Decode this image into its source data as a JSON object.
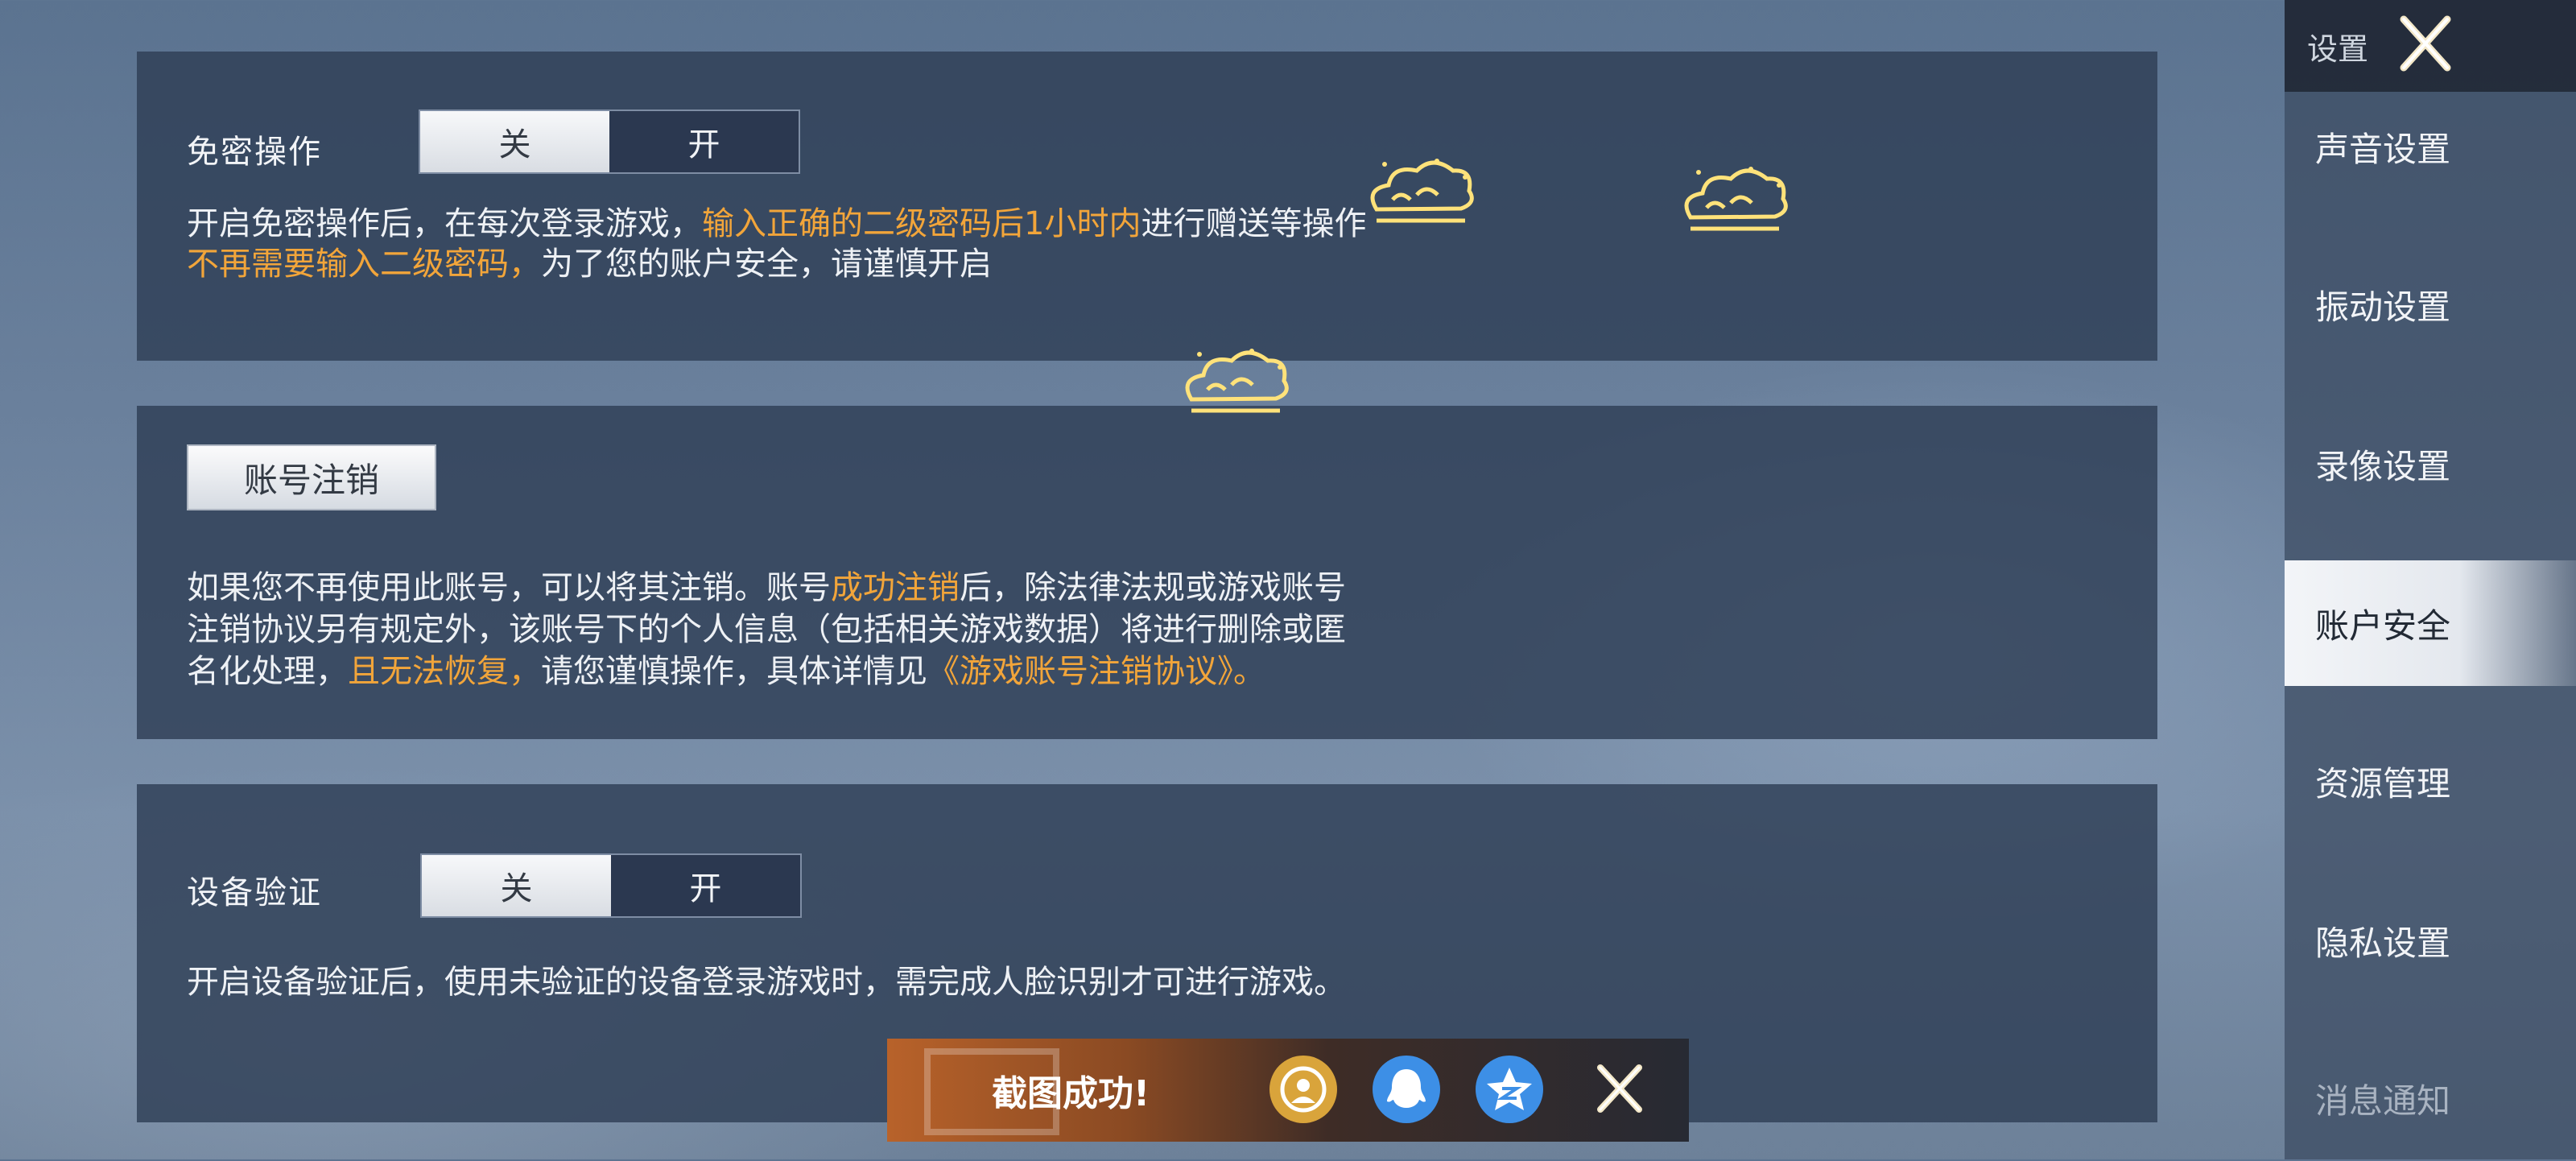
{
  "sidebar": {
    "title": "设置",
    "items": [
      {
        "label": "声音设置"
      },
      {
        "label": "振动设置"
      },
      {
        "label": "录像设置"
      },
      {
        "label": "账户安全"
      },
      {
        "label": "资源管理"
      },
      {
        "label": "隐私设置"
      },
      {
        "label": "消息通知"
      }
    ],
    "active_item": "账户安全"
  },
  "no_password": {
    "label": "免密操作",
    "toggle_off": "关",
    "toggle_on": "开",
    "selected": "关",
    "desc1_a": "开启免密操作后，在每次登录游戏，",
    "desc1_hl": "输入正确的二级密码后1小时内",
    "desc1_b": "进行赠送等操作",
    "desc2_hl": "不再需要输入二级密码，",
    "desc2_b": "为了您的账户安全，请谨慎开启"
  },
  "account_cancel": {
    "button": "账号注销",
    "line1_a": "如果您不再使用此账号，可以将其注销。账号",
    "line1_hl": "成功注销",
    "line1_b": "后，除法律法规或游戏账号",
    "line2": "注销协议另有规定外，该账号下的个人信息（包括相关游戏数据）将进行删除或匿",
    "line3_a": "名化处理，",
    "line3_hl": "且无法恢复，",
    "line3_b": "请您谨慎操作，具体详情见",
    "line3_link": "《游戏账号注销协议》。"
  },
  "device_verify": {
    "label": "设备验证",
    "toggle_off": "关",
    "toggle_on": "开",
    "selected": "关",
    "desc": "开启设备验证后，使用未验证的设备登录游戏时，需完成人脸识别才可进行游戏。"
  },
  "toast": {
    "text": "截图成功!",
    "icons": [
      "gold-share-icon",
      "qq-icon",
      "qzone-icon",
      "close-icon"
    ]
  },
  "colors": {
    "highlight": "#f2a53a",
    "panel": "#2e3e55",
    "toggle_on_bg": "#e8ebef"
  }
}
